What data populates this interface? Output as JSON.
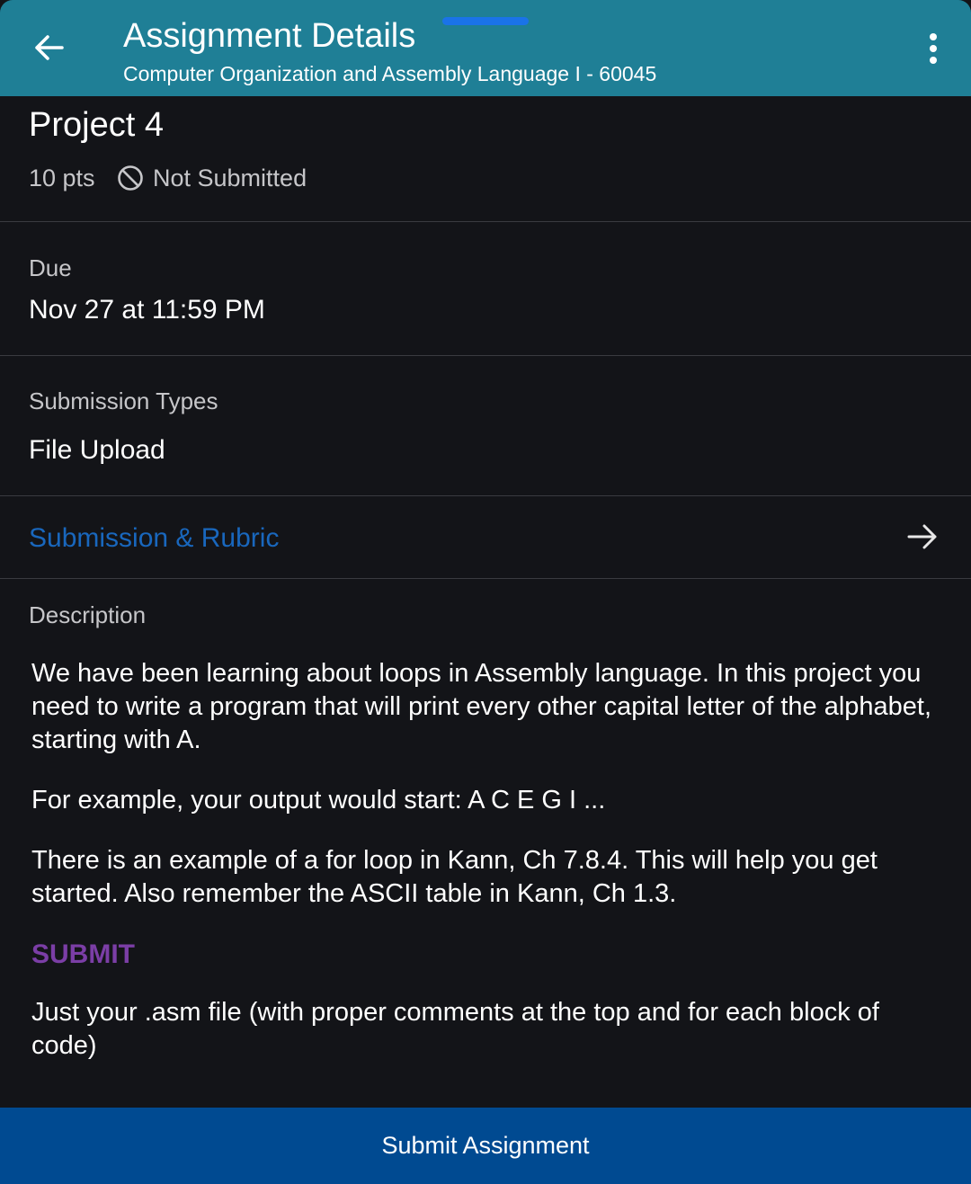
{
  "header": {
    "title": "Assignment Details",
    "subtitle": "Computer Organization and Assembly Language I - 60045",
    "back_icon": "arrow-left-icon",
    "menu_icon": "more-vertical-icon",
    "background": "#1f7f96"
  },
  "assignment": {
    "name": "Project 4",
    "points": "10 pts",
    "status_icon": "not-submitted-icon",
    "status": "Not Submitted"
  },
  "due": {
    "label": "Due",
    "value": "Nov 27 at 11:59 PM"
  },
  "submission_types": {
    "label": "Submission Types",
    "value": "File Upload"
  },
  "rubric": {
    "label": "Submission & Rubric",
    "icon": "arrow-right-icon",
    "color": "#1967bd"
  },
  "description": {
    "label": "Description",
    "paragraph1": "We have been learning about loops in Assembly language.  In this project you need to write a program that will print every other capital letter of the alphabet, starting with A.",
    "paragraph2": "For example, your output would start:  A C E G I ...",
    "paragraph3": "There is an example of a for loop in Kann, Ch 7.8.4.  This will help you get started.  Also remember the ASCII table in Kann, Ch 1.3.",
    "submit_heading": "SUBMIT",
    "paragraph4": "Just your .asm file (with proper comments at the top and for each block of code)"
  },
  "footer": {
    "submit_label": "Submit Assignment",
    "background": "#004a91"
  }
}
